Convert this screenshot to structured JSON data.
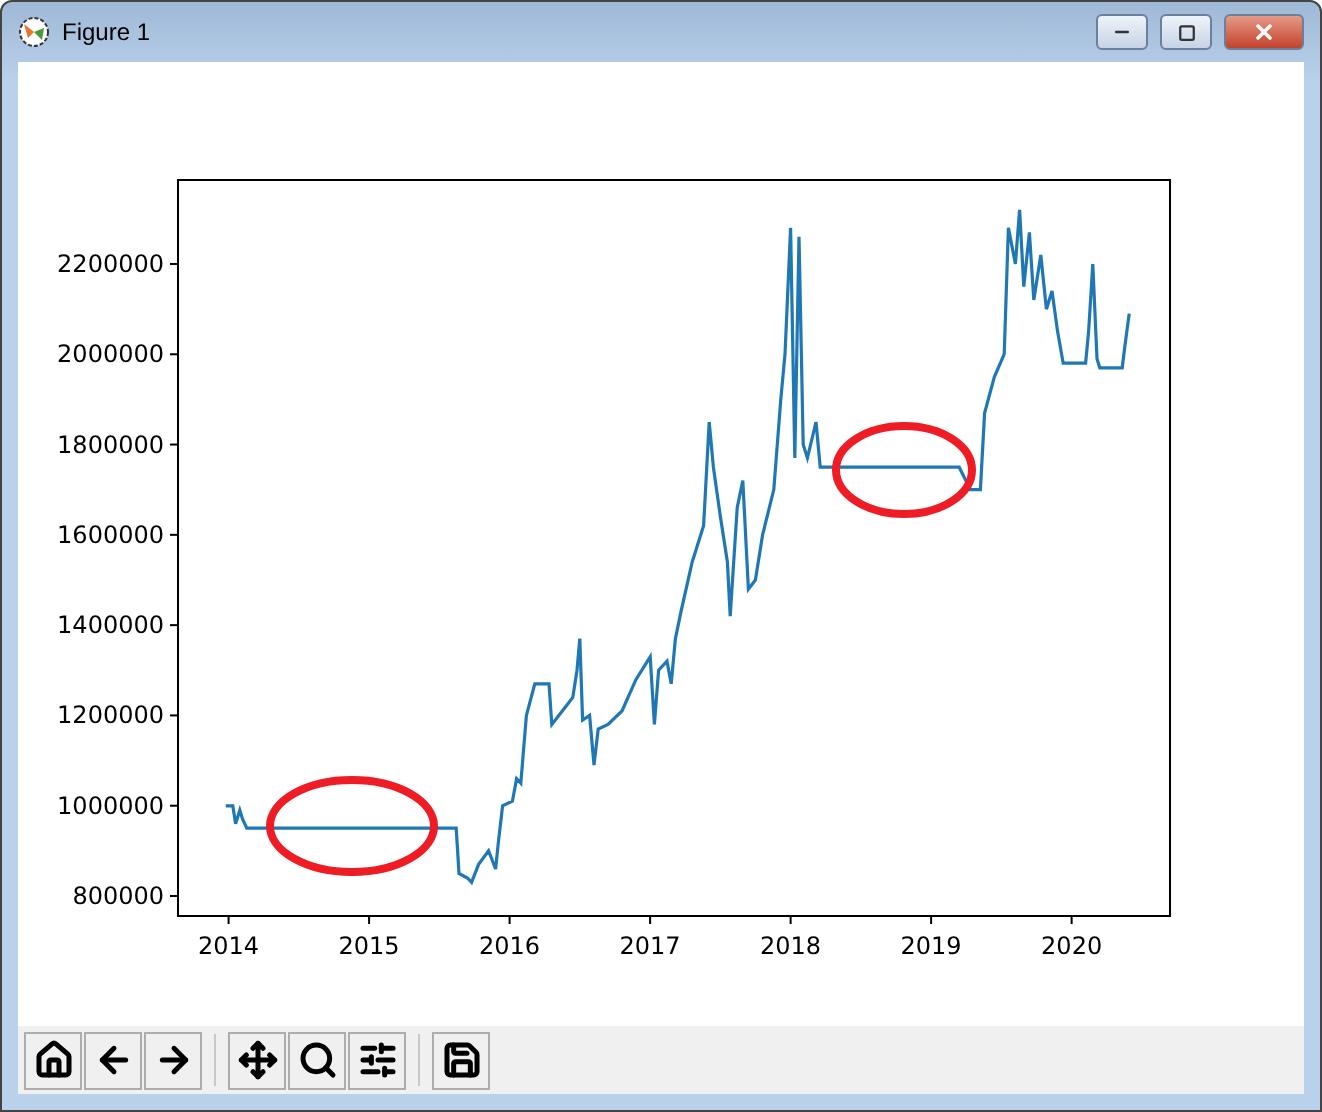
{
  "window": {
    "title": "Figure 1"
  },
  "figure": {
    "chart_data": {
      "type": "line",
      "xlim": [
        2013.64,
        2020.7
      ],
      "ylim": [
        755700,
        2386000
      ],
      "xticks": [
        2014,
        2015,
        2016,
        2017,
        2018,
        2019,
        2020
      ],
      "yticks": [
        800000,
        1000000,
        1200000,
        1400000,
        1600000,
        1800000,
        2000000,
        2200000
      ],
      "series": [
        {
          "color": "#1f77b4",
          "x": [
            2013.98,
            2014.03,
            2014.05,
            2014.08,
            2014.1,
            2014.13,
            2015.62,
            2015.64,
            2015.7,
            2015.73,
            2015.78,
            2015.85,
            2015.9,
            2015.92,
            2015.95,
            2016.02,
            2016.05,
            2016.08,
            2016.12,
            2016.18,
            2016.28,
            2016.3,
            2016.35,
            2016.4,
            2016.45,
            2016.48,
            2016.5,
            2016.52,
            2016.57,
            2016.6,
            2016.63,
            2016.7,
            2016.8,
            2016.9,
            2017.0,
            2017.03,
            2017.06,
            2017.12,
            2017.15,
            2017.18,
            2017.22,
            2017.3,
            2017.38,
            2017.42,
            2017.45,
            2017.5,
            2017.55,
            2017.57,
            2017.62,
            2017.66,
            2017.7,
            2017.75,
            2017.8,
            2017.88,
            2017.93,
            2017.96,
            2018.0,
            2018.03,
            2018.06,
            2018.09,
            2018.12,
            2018.18,
            2018.21,
            2019.2,
            2019.28,
            2019.35,
            2019.38,
            2019.45,
            2019.52,
            2019.55,
            2019.6,
            2019.63,
            2019.66,
            2019.7,
            2019.73,
            2019.78,
            2019.82,
            2019.86,
            2019.9,
            2019.94,
            2020.1,
            2020.12,
            2020.15,
            2020.18,
            2020.2,
            2020.36,
            2020.38,
            2020.41
          ],
          "values": [
            1000000,
            1000000,
            960000,
            990000,
            970000,
            950000,
            950000,
            850000,
            840000,
            830000,
            870000,
            900000,
            860000,
            920000,
            1000000,
            1010000,
            1060000,
            1050000,
            1200000,
            1270000,
            1270000,
            1180000,
            1200000,
            1220000,
            1240000,
            1300000,
            1370000,
            1190000,
            1200000,
            1090000,
            1170000,
            1180000,
            1210000,
            1280000,
            1330000,
            1180000,
            1300000,
            1320000,
            1270000,
            1370000,
            1430000,
            1540000,
            1620000,
            1850000,
            1750000,
            1640000,
            1540000,
            1420000,
            1660000,
            1720000,
            1480000,
            1500000,
            1600000,
            1700000,
            1900000,
            2000000,
            2280000,
            1770000,
            2260000,
            1800000,
            1770000,
            1850000,
            1750000,
            1750000,
            1700000,
            1700000,
            1870000,
            1950000,
            2000000,
            2280000,
            2200000,
            2320000,
            2150000,
            2270000,
            2120000,
            2220000,
            2100000,
            2140000,
            2050000,
            1980000,
            1980000,
            2050000,
            2200000,
            1990000,
            1970000,
            1970000,
            2020000,
            2090000
          ]
        }
      ]
    }
  }
}
